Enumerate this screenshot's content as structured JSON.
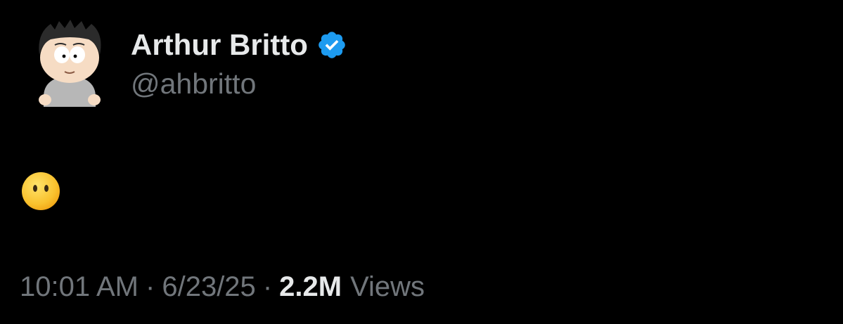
{
  "author": {
    "display_name": "Arthur Britto",
    "handle": "@ahbritto",
    "verified": true,
    "avatar_icon": "south-park-character-avatar"
  },
  "post": {
    "content_emoji": "face-without-mouth-emoji",
    "content_text": ""
  },
  "meta": {
    "time": "10:01 AM",
    "separator": "·",
    "date": "6/23/25",
    "views_count": "2.2M",
    "views_label": "Views"
  },
  "colors": {
    "background": "#000000",
    "primary_text": "#e7e9ea",
    "secondary_text": "#71767b",
    "verified_blue": "#1d9bf0"
  }
}
